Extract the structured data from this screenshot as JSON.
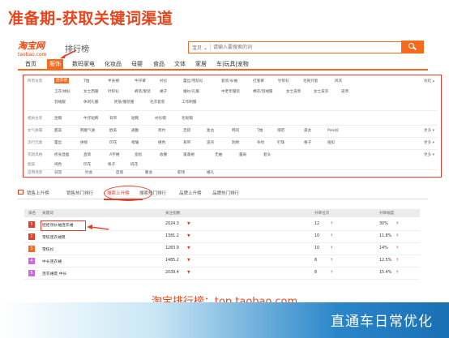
{
  "slide_title": "准备期-获取关键词渠道",
  "taobao": {
    "logo_cn": "淘宝网",
    "logo_en": "taobao.com",
    "rank_label": "排行榜",
    "search_select": "宝贝 ⌄",
    "search_placeholder": "请输入要搜索的词"
  },
  "nav": [
    {
      "label": "首页",
      "active": false
    },
    {
      "label": "服饰",
      "active": true
    },
    {
      "label": "数码家电",
      "active": false
    },
    {
      "label": "化妆品",
      "active": false
    },
    {
      "label": "母婴",
      "active": false
    },
    {
      "label": "食品",
      "active": false
    },
    {
      "label": "文体",
      "active": false
    },
    {
      "label": "家居",
      "active": false
    },
    {
      "label": "车|玩具|宠物",
      "active": false
    }
  ],
  "filters": [
    {
      "label": "所有女装",
      "options": [
        "连衣裙",
        "T恤",
        "半身裙",
        "牛仔裤",
        "衬衫",
        "蕾丝/雪纺衫",
        "套装/长袖",
        "打底裤",
        "针织衫",
        "毛呢外套",
        "风衣"
      ],
      "active": 0,
      "more": "收起 ▴"
    },
    {
      "label": "",
      "options": [
        "卫衣/绒衫",
        "女士西服",
        "针织衫",
        "裤装/套装",
        "裙子",
        "婚纱/礼服",
        "中老年服装",
        "棉衣/羽绒服",
        "女士皮草",
        "女士皮衣",
        "皮草"
      ],
      "active": -1,
      "more": ""
    },
    {
      "label": "",
      "options": [
        "羽绒服",
        "休闲礼服",
        "民族/服装服",
        "毛衣套装",
        "工作制服"
      ],
      "active": -1,
      "more": ""
    },
    {
      "label": "相关女装",
      "options": [
        "连帽",
        "牛仔短裤",
        "背带",
        "短靴",
        "衬衫帽",
        "毛呢帽"
      ],
      "active": -1,
      "more": ""
    },
    {
      "label": "女气质属",
      "options": [
        "甜美",
        "韩版气质",
        "欧美",
        "通勤",
        "简约",
        "百搭",
        "复古",
        "韩风",
        "T恤",
        "潮范",
        "森女",
        "Polo衫"
      ],
      "active": -1,
      "more": "更多 ▾"
    },
    {
      "label": "流行元素",
      "options": [
        "蕾丝",
        "拼接",
        "印花",
        "褶皱",
        "撞色",
        "系带",
        "波点",
        "刺绣",
        "条纹",
        "钉珠",
        "格子",
        "纽扣"
      ],
      "active": -1,
      "more": "更多 ▾"
    },
    {
      "label": "衣款风格",
      "options": [
        "修身显瘦",
        "直筒",
        "A字裙",
        "宽松",
        "收腰",
        "蓬蓬裙",
        "无袖",
        "露肩",
        "套头"
      ],
      "active": -1,
      "more": "更多 ▾"
    },
    {
      "label": "图案",
      "options": [
        "纯色",
        "印花",
        "格子",
        "碎花"
      ],
      "active": -1,
      "more": ""
    },
    {
      "label": "适用场景",
      "options": [
        "日常",
        "约会",
        "度假",
        "聚会",
        "职场",
        "婚礼"
      ],
      "active": -1,
      "more": ""
    }
  ],
  "tabs": [
    {
      "label": "销售上升榜",
      "active": false
    },
    {
      "label": "销售热门排行",
      "active": false
    },
    {
      "label": "搜索上升榜",
      "active": true
    },
    {
      "label": "搜索热门排行",
      "active": false
    },
    {
      "label": "品牌上升榜",
      "active": false
    },
    {
      "label": "品牌热门排行",
      "active": false
    }
  ],
  "table": {
    "headers": [
      "排名",
      "关键词",
      "关注指数",
      "升降位次",
      "升降幅度"
    ],
    "rows": [
      {
        "rank": "1",
        "keyword": "娃娃领长袖连衣裙",
        "index": "2024.3",
        "change": "12",
        "percent": "30%",
        "rank_color": "#e43d2b"
      },
      {
        "rank": "2",
        "keyword": "雪纺连衣裙夏",
        "index": "1381.2",
        "change": "10",
        "percent": "11.8%",
        "rank_color": "#e43d2b"
      },
      {
        "rank": "3",
        "keyword": "雪纺衫",
        "index": "1283.9",
        "change": "10",
        "percent": "14%",
        "rank_color": "#f56b1d"
      },
      {
        "rank": "4",
        "keyword": "中长连衣裙",
        "index": "1485.2",
        "change": "8",
        "percent": "12.5%",
        "rank_color": "#c96be0"
      },
      {
        "rank": "5",
        "keyword": "连衣裙夏 中长",
        "index": "2039.4",
        "change": "8",
        "percent": "15.4%",
        "rank_color": "#c96be0"
      }
    ]
  },
  "caption": "淘宝排行榜：top.taobao.com",
  "footer_title": "直通车日常优化"
}
